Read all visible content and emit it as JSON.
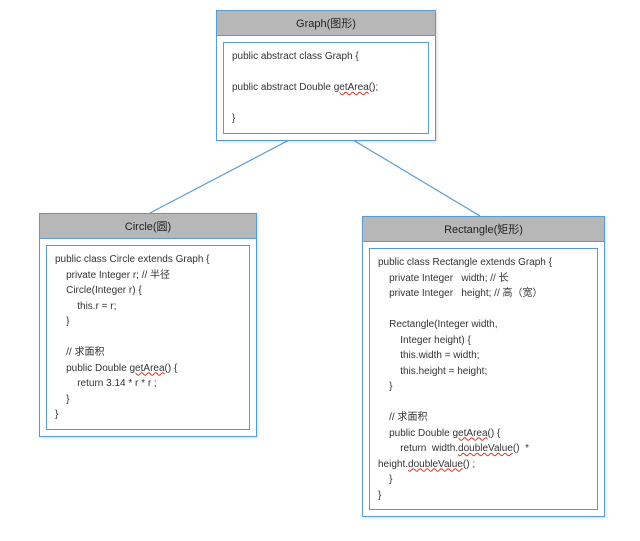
{
  "graph": {
    "title": "Graph(图形)",
    "code": {
      "line1": "public abstract class Graph {",
      "line2a": "public abstract Double ",
      "line2b": "getArea",
      "line2c": "();",
      "line3": "}"
    }
  },
  "circle": {
    "title": "Circle(圆)",
    "code": {
      "l1a": "public class Circle extends Graph {",
      "l2": "    private Integer r; // 半径",
      "l3": "    Circle(Integer r) {",
      "l4": "        this.r = r;",
      "l5": "    }",
      "l6": "",
      "l7": "    // 求面积",
      "l8a": "    public Double ",
      "l8b": "getArea",
      "l8c": "() {",
      "l9": "        return 3.14 * r * r ;",
      "l10": "    }",
      "l11": "}"
    }
  },
  "rectangle": {
    "title": "Rectangle(矩形)",
    "code": {
      "l1": "public class Rectangle extends Graph {",
      "l2": "    private Integer   width; // 长",
      "l3": "    private Integer   height; // 高（宽）",
      "l4": "",
      "l5": "    Rectangle(Integer width,",
      "l6": "        Integer height) {",
      "l7": "        this.width = width;",
      "l8": "        this.height = height;",
      "l9": "    }",
      "l10": "",
      "l11": "    // 求面积",
      "l12a": "    public Double ",
      "l12b": "getArea",
      "l12c": "() {",
      "l13a": "        return  width.",
      "l13b": "doubleValue",
      "l13c": "()  *",
      "l14a": "height.",
      "l14b": "doubleValue",
      "l14c": "() ;",
      "l15": "    }",
      "l16": "}"
    }
  }
}
